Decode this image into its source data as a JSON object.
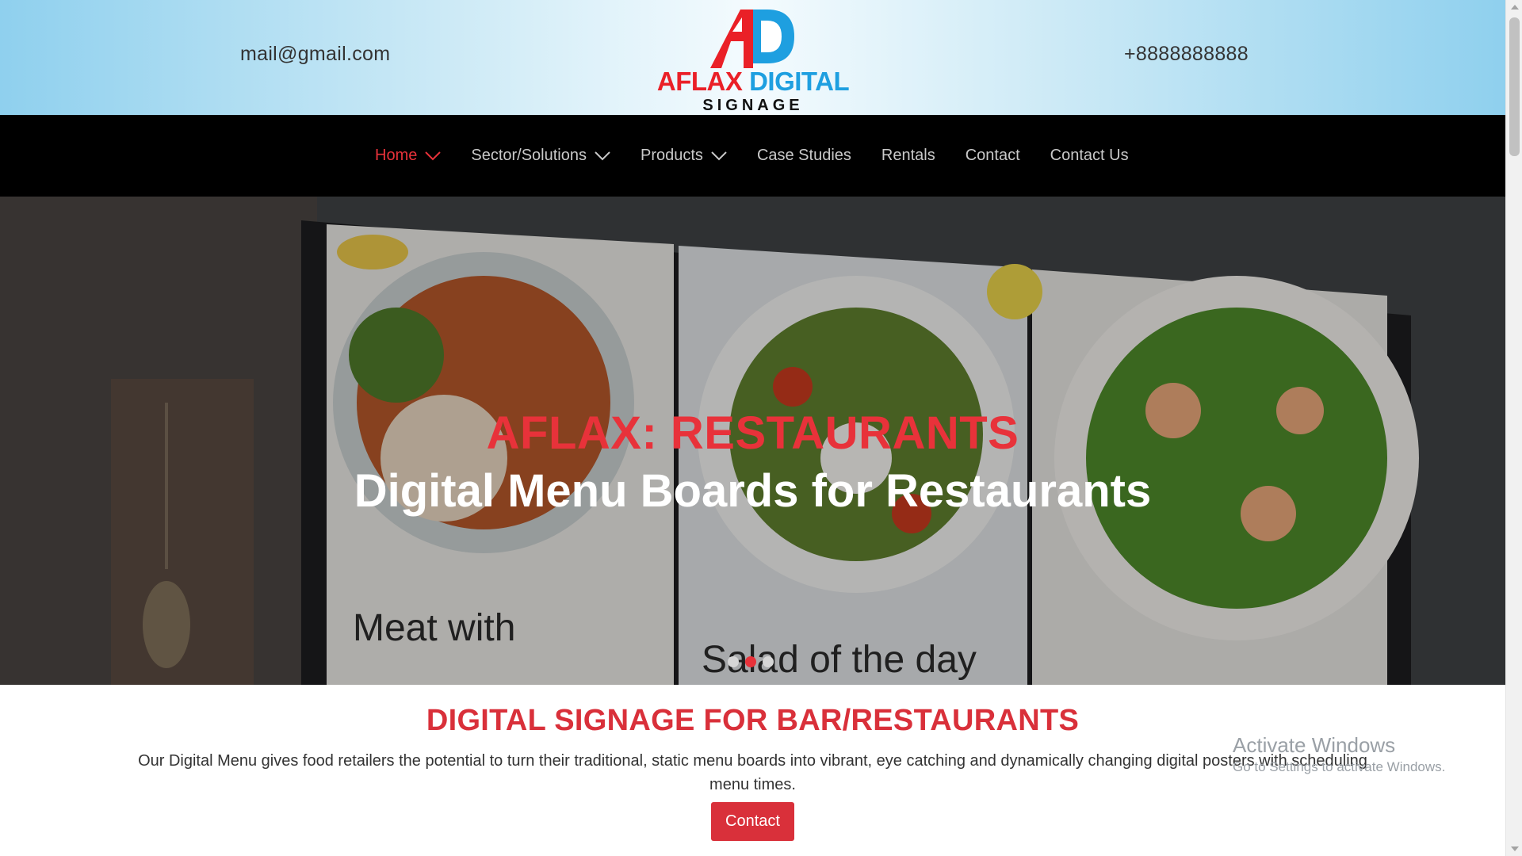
{
  "header": {
    "email": "mail@gmail.com",
    "phone": "+8888888888",
    "logo": {
      "word_red": "AFLAX",
      "word_blue": "DIGITAL",
      "subtitle": "SIGNAGE"
    }
  },
  "nav": {
    "items": [
      {
        "label": "Home",
        "active": true,
        "has_dropdown": true
      },
      {
        "label": "Sector/Solutions",
        "active": false,
        "has_dropdown": true
      },
      {
        "label": "Products",
        "active": false,
        "has_dropdown": true
      },
      {
        "label": "Case Studies",
        "active": false,
        "has_dropdown": false
      },
      {
        "label": "Rentals",
        "active": false,
        "has_dropdown": false
      },
      {
        "label": "Contact",
        "active": false,
        "has_dropdown": false
      },
      {
        "label": "Contact Us",
        "active": false,
        "has_dropdown": false
      }
    ]
  },
  "hero": {
    "kicker": "AFLAX: RESTAURANTS",
    "headline": "Digital Menu Boards for Restaurants",
    "image_text_left": "Meat with",
    "image_text_mid": "Salad of the day",
    "slides": 3,
    "active_slide": 2
  },
  "intro": {
    "title": "DIGITAL SIGNAGE FOR BAR/RESTAURANTS",
    "text": "Our Digital Menu gives food retailers the potential to turn their traditional, static menu boards into vibrant, eye catching and dynamically changing digital posters with scheduling menu times.",
    "button_label": "Contact"
  },
  "watermark": {
    "line1": "Activate Windows",
    "line2": "Go to Settings to activate Windows."
  },
  "colors": {
    "accent_red": "#d9303a",
    "nav_bg": "#000000",
    "header_gradient_edge": "#8fd0ee",
    "logo_blue": "#1e9fe0"
  }
}
